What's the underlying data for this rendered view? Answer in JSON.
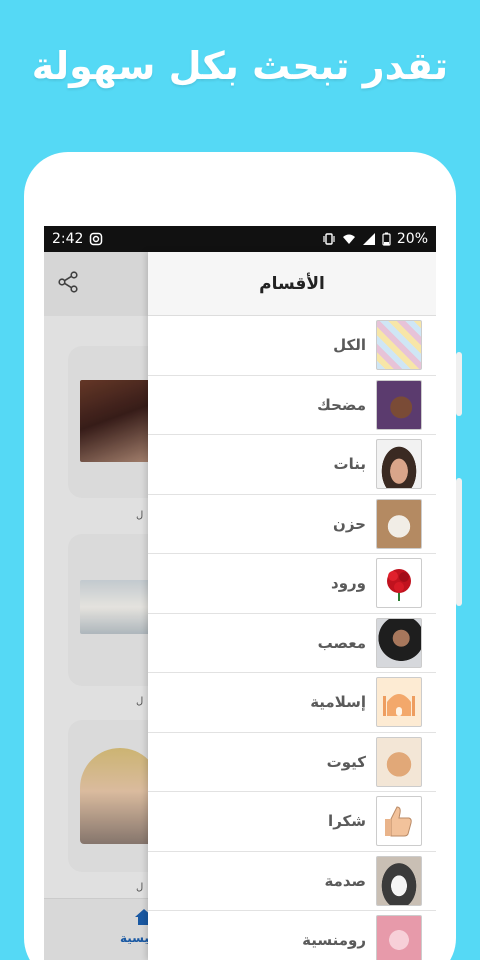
{
  "promo": {
    "title": "تقدر تبحث بكل سهولة"
  },
  "status_bar": {
    "time": "2:42",
    "battery": "20%"
  },
  "drawer": {
    "title": "الأقسام",
    "categories": [
      {
        "label": "الكل",
        "icon": "collage-thumbnail",
        "color": "#f4f4f4"
      },
      {
        "label": "مضحك",
        "icon": "laughing-man-thumbnail",
        "color": "#6a4a7e"
      },
      {
        "label": "بنات",
        "icon": "crying-woman-thumbnail",
        "color": "#eaeaea"
      },
      {
        "label": "حزن",
        "icon": "sad-cat-thumbnail",
        "color": "#b89a7a"
      },
      {
        "label": "ورود",
        "icon": "roses-thumbnail",
        "color": "#ffffff"
      },
      {
        "label": "معصب",
        "icon": "angry-man-thumbnail",
        "color": "#cfd2d6"
      },
      {
        "label": "إسلامية",
        "icon": "mosque-thumbnail",
        "color": "#fbe8cf"
      },
      {
        "label": "كيوت",
        "icon": "cute-cat-thumbnail",
        "color": "#e8d3b8"
      },
      {
        "label": "شكرا",
        "icon": "thumbs-up-thumbnail",
        "color": "#ffffff"
      },
      {
        "label": "صدمة",
        "icon": "shocked-dog-thumbnail",
        "color": "#cfc6bd"
      },
      {
        "label": "رومنسية",
        "icon": "romantic-thumbnail",
        "color": "#f0b8c2"
      }
    ]
  },
  "bottom_nav": {
    "home_label": "الرئيسية"
  }
}
